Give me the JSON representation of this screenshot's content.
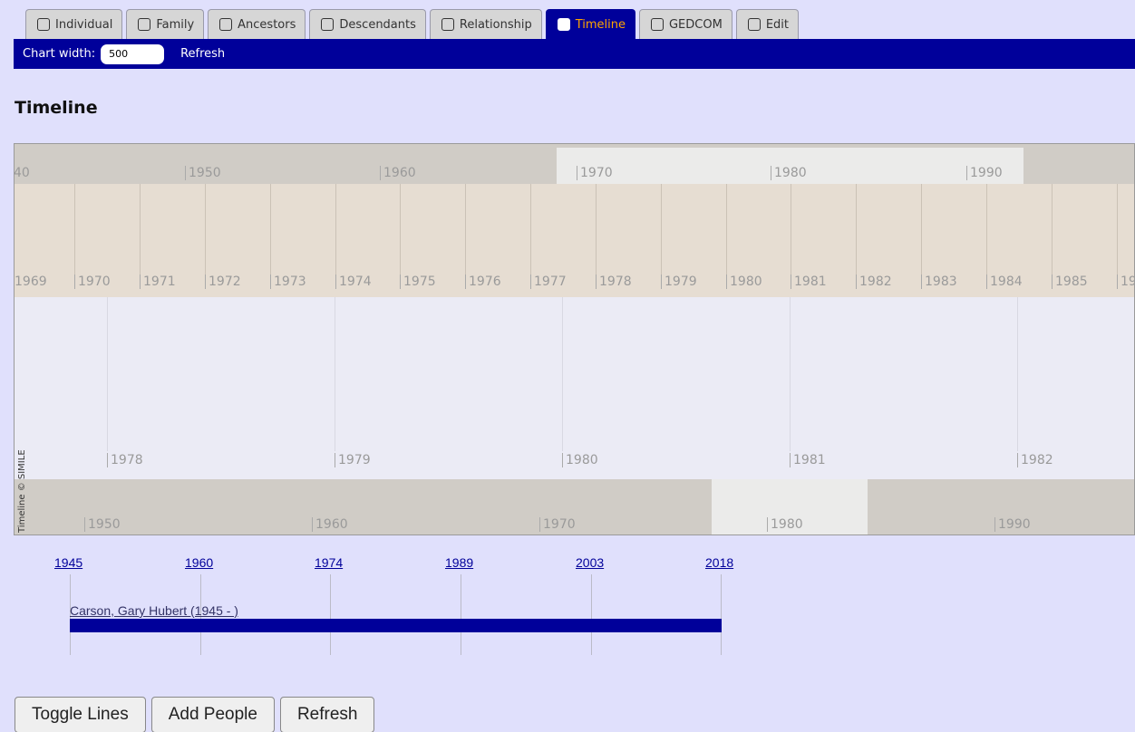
{
  "tabs": [
    {
      "label": "Individual",
      "icon": "person-icon"
    },
    {
      "label": "Family",
      "icon": "family-icon"
    },
    {
      "label": "Ancestors",
      "icon": "ancestors-icon"
    },
    {
      "label": "Descendants",
      "icon": "descendants-icon"
    },
    {
      "label": "Relationship",
      "icon": "relationship-icon"
    },
    {
      "label": "Timeline",
      "icon": "timeline-icon",
      "active": true
    },
    {
      "label": "GEDCOM",
      "icon": "gedcom-icon"
    },
    {
      "label": "Edit",
      "icon": "edit-icon"
    }
  ],
  "toolbar": {
    "chart_width_label": "Chart width:",
    "chart_width_value": "500",
    "refresh_label": "Refresh"
  },
  "page_title": "Timeline",
  "simile": {
    "band1_ticks": [
      "40",
      "1950",
      "1960",
      "1970",
      "1980",
      "1990"
    ],
    "band2_ticks": [
      "1969",
      "1970",
      "1971",
      "1972",
      "1973",
      "1974",
      "1975",
      "1976",
      "1977",
      "1978",
      "1979",
      "1980",
      "1981",
      "1982",
      "1983",
      "1984",
      "1985",
      "19"
    ],
    "band3_ticks": [
      "1978",
      "1979",
      "1980",
      "1981",
      "1982"
    ],
    "band4_ticks": [
      "1950",
      "1960",
      "1970",
      "1980",
      "1990"
    ],
    "credit": "Timeline © SIMILE"
  },
  "chart": {
    "years": [
      "1945",
      "1960",
      "1974",
      "1989",
      "2003",
      "2018"
    ],
    "person_label": "Carson, Gary Hubert (1945 - )",
    "bar_color": "#00009a"
  },
  "buttons": {
    "toggle_lines": "Toggle Lines",
    "add_people": "Add People",
    "refresh": "Refresh"
  }
}
